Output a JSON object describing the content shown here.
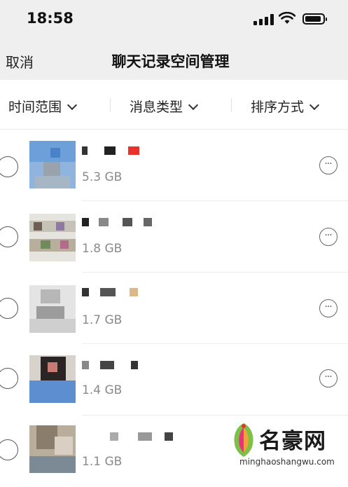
{
  "status_bar": {
    "time": "18:58"
  },
  "nav": {
    "cancel_label": "取消",
    "title": "聊天记录空间管理"
  },
  "filters": [
    {
      "label": "时间范围"
    },
    {
      "label": "消息类型"
    },
    {
      "label": "排序方式"
    }
  ],
  "chats": [
    {
      "size": "5.3 GB"
    },
    {
      "size": "1.8 GB"
    },
    {
      "size": "1.7 GB"
    },
    {
      "size": "1.4 GB"
    },
    {
      "size": "1.1 GB"
    }
  ],
  "watermark": {
    "brand": "名豪网",
    "url": "minghaoshangwu.com"
  },
  "colors": {
    "bar_bg": "#efefef",
    "secondary_text": "#8a8a8a",
    "accent_red": "#e8322c"
  }
}
